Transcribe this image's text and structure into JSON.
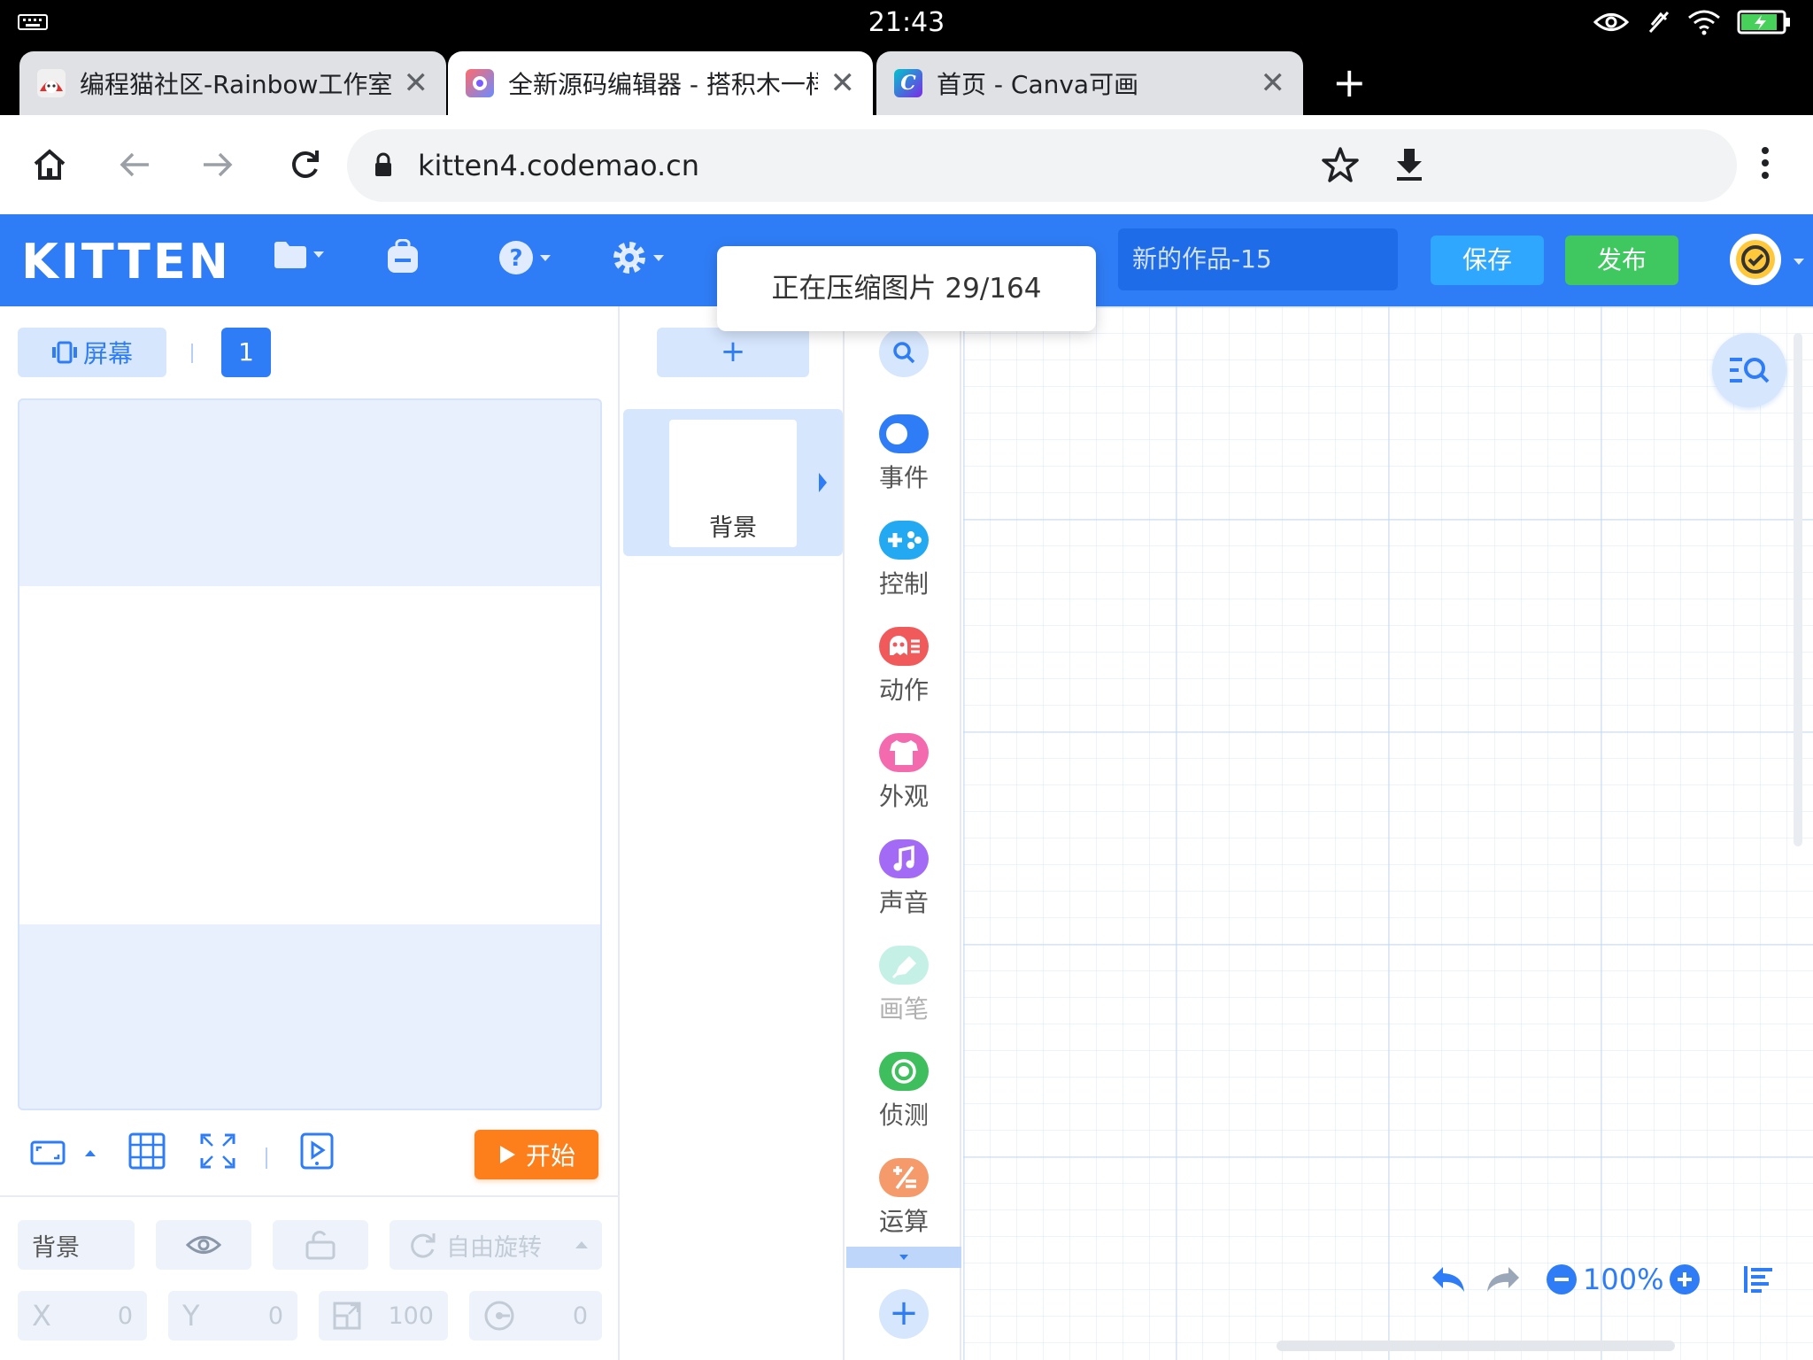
{
  "status_bar": {
    "time": "21:43"
  },
  "tabs": [
    {
      "title": "编程猫社区-Rainbow工作室-",
      "favicon": "codemao-cat-icon",
      "active": false
    },
    {
      "title": "全新源码编辑器 - 搭积木一样",
      "favicon": "kitten-editor-icon",
      "active": true
    },
    {
      "title": "首页 - Canva可画",
      "favicon": "canva-icon",
      "active": false
    }
  ],
  "address_bar": {
    "url": "kitten4.codemao.cn"
  },
  "kitten": {
    "logo": "KITTEN",
    "project_name": "新的作品-15",
    "save_label": "保存",
    "publish_label": "发布",
    "toast": "正在压缩图片 29/164"
  },
  "stage": {
    "screen_label": "屏幕",
    "screen_number": "1",
    "start_label": "开始"
  },
  "properties": {
    "name": "背景",
    "rotation_label": "自由旋转",
    "x_label": "X",
    "x_value": "0",
    "y_label": "Y",
    "y_value": "0",
    "size_value": "100",
    "direction_value": "0"
  },
  "sprites": {
    "add_label": "+",
    "items": [
      {
        "name": "背景"
      }
    ]
  },
  "categories": [
    {
      "label": "事件",
      "color": "#2f7df6",
      "icon": "toggle-icon"
    },
    {
      "label": "控制",
      "color": "#23a9f2",
      "icon": "gamepad-icon"
    },
    {
      "label": "动作",
      "color": "#f05a5a",
      "icon": "ghost-icon"
    },
    {
      "label": "外观",
      "color": "#f36aaf",
      "icon": "shirt-icon"
    },
    {
      "label": "声音",
      "color": "#a36af5",
      "icon": "music-note-icon"
    },
    {
      "label": "画笔",
      "color": "#7fe0c8",
      "icon": "pen-icon"
    },
    {
      "label": "侦测",
      "color": "#3ebe5d",
      "icon": "target-icon"
    },
    {
      "label": "运算",
      "color": "#f59a6a",
      "icon": "math-icon"
    }
  ],
  "workspace": {
    "zoom": "100%"
  },
  "colors": {
    "brand": "#2f7df6",
    "save": "#2fa7ff",
    "publish": "#3ec85f",
    "start": "#fd7f1b"
  }
}
